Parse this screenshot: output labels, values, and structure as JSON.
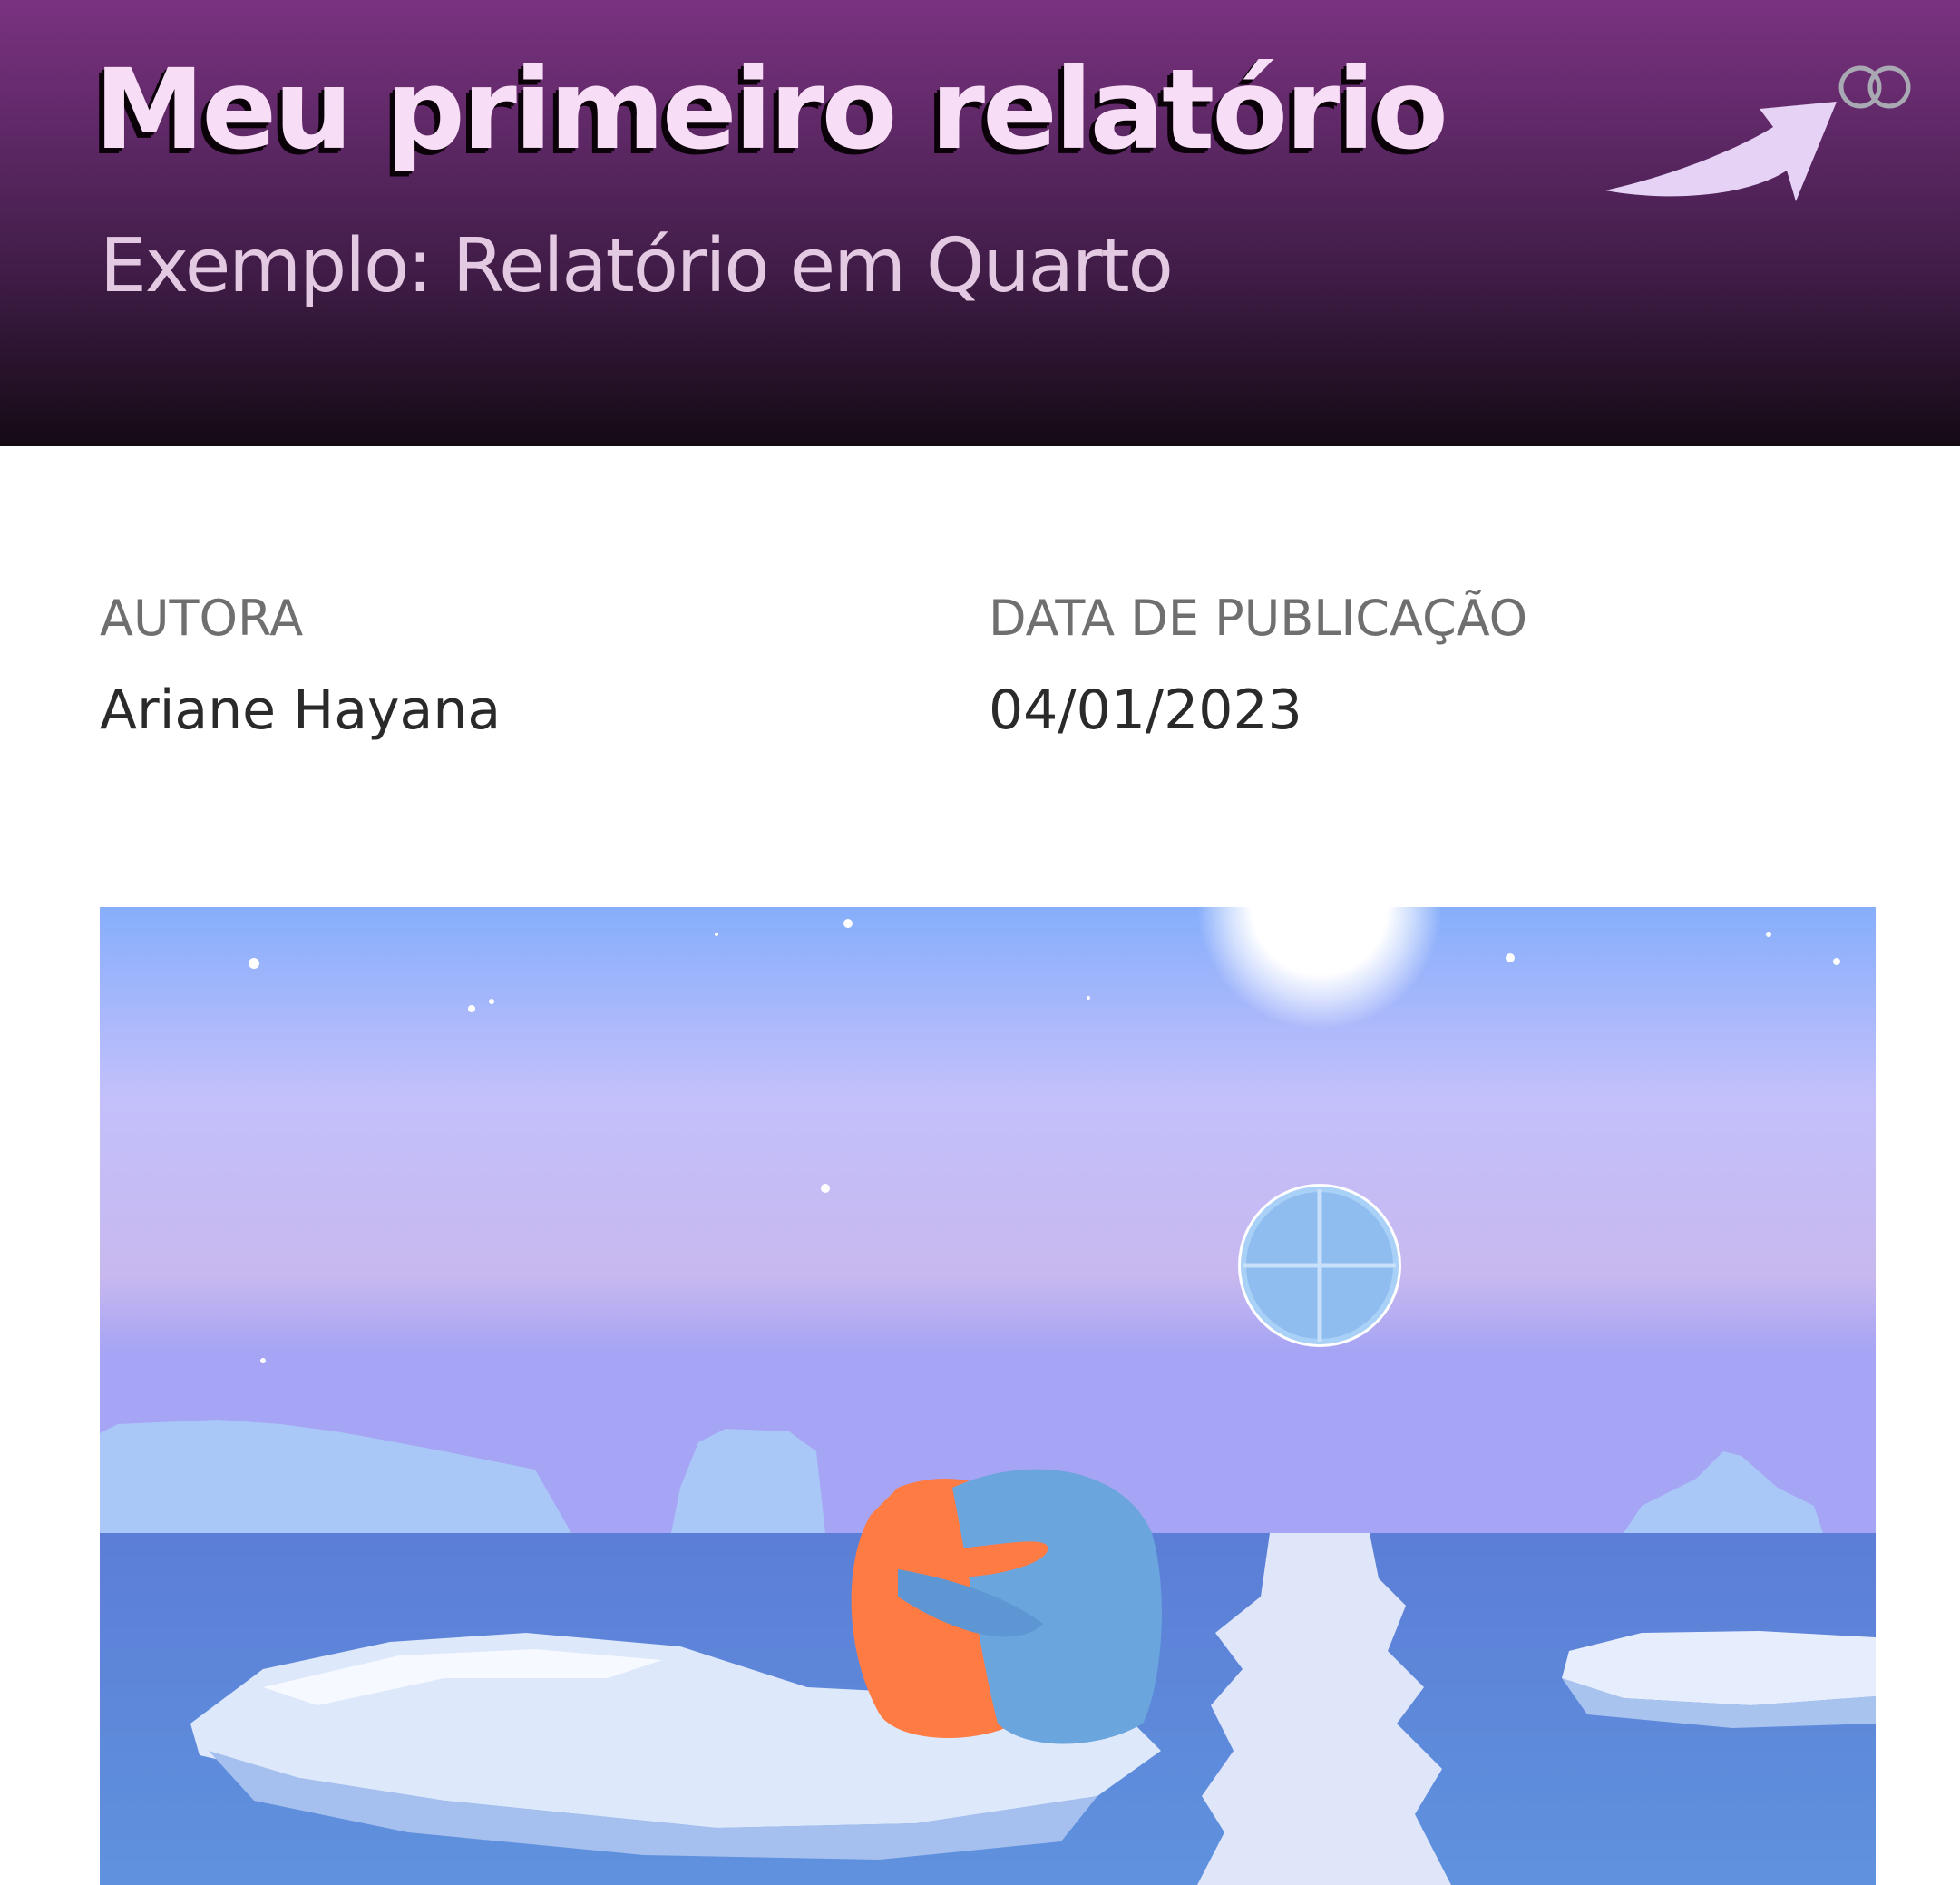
{
  "header": {
    "title": "Meu primeiro relatório",
    "subtitle": "Exemplo: Relatório em Quarto",
    "toggle_icon": "toggle-icon",
    "gradient_colors": [
      "#7a3280",
      "#3f1c46",
      "#140a14"
    ],
    "title_color": "#f7ddf5",
    "annotation_arrow_color": "#e6d2f5"
  },
  "meta": {
    "author_label": "AUTORA",
    "author_value": "Ariane Hayana",
    "date_label": "DATA DE PUBLICAÇÃO",
    "date_value": "04/01/2023"
  },
  "illustration": {
    "subject": "two penguins hugging on an ice floe under the moon",
    "palette": {
      "sky_top": "#86aefb",
      "sky_mid": "#c3c0fb",
      "water": "#5f8bd8",
      "orange_penguin": "#ff7b44",
      "blue_penguin": "#6aa5de"
    }
  }
}
